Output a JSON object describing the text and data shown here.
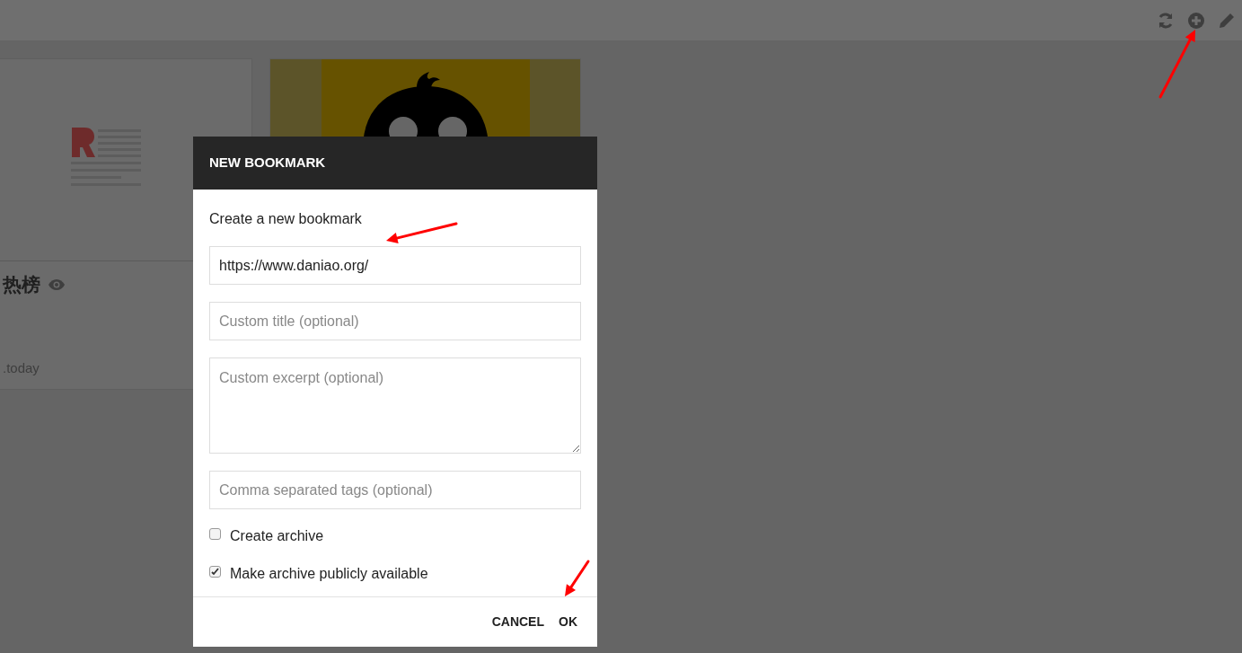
{
  "cards": [
    {
      "title": "热榜",
      "source": ".today"
    }
  ],
  "dialog": {
    "title": "NEW BOOKMARK",
    "subtitle": "Create a new bookmark",
    "fields": [
      {
        "kind": "input",
        "value": "https://www.daniao.org/"
      },
      {
        "kind": "input",
        "placeholder": "Custom title (optional)"
      },
      {
        "kind": "textarea",
        "placeholder": "Custom excerpt (optional)"
      },
      {
        "kind": "input",
        "placeholder": "Comma separated tags (optional)"
      }
    ],
    "checkboxes": [
      {
        "label": "Create archive",
        "checked": false
      },
      {
        "label": "Make archive publicly available",
        "checked": true
      }
    ],
    "buttons": [
      "CANCEL",
      "OK"
    ]
  }
}
